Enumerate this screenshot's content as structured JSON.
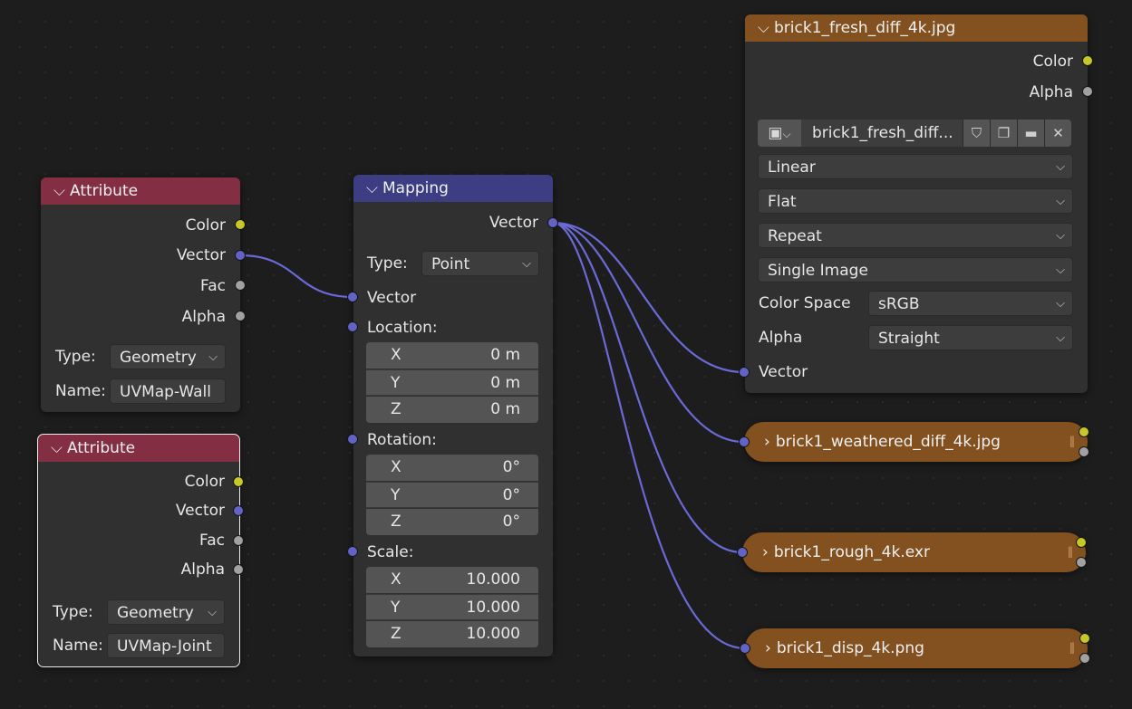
{
  "attr1": {
    "title": "Attribute",
    "outputs": [
      "Color",
      "Vector",
      "Fac",
      "Alpha"
    ],
    "type_label": "Type:",
    "type_value": "Geometry",
    "name_label": "Name:",
    "name_value": "UVMap-Wall"
  },
  "attr2": {
    "title": "Attribute",
    "outputs": [
      "Color",
      "Vector",
      "Fac",
      "Alpha"
    ],
    "type_label": "Type:",
    "type_value": "Geometry",
    "name_label": "Name:",
    "name_value": "UVMap-Joint"
  },
  "mapping": {
    "title": "Mapping",
    "output": "Vector",
    "type_label": "Type:",
    "type_value": "Point",
    "input_vector": "Vector",
    "location_label": "Location:",
    "location": [
      {
        "axis": "X",
        "value": "0 m"
      },
      {
        "axis": "Y",
        "value": "0 m"
      },
      {
        "axis": "Z",
        "value": "0 m"
      }
    ],
    "rotation_label": "Rotation:",
    "rotation": [
      {
        "axis": "X",
        "value": "0°"
      },
      {
        "axis": "Y",
        "value": "0°"
      },
      {
        "axis": "Z",
        "value": "0°"
      }
    ],
    "scale_label": "Scale:",
    "scale": [
      {
        "axis": "X",
        "value": "10.000"
      },
      {
        "axis": "Y",
        "value": "10.000"
      },
      {
        "axis": "Z",
        "value": "10.000"
      }
    ]
  },
  "image_node": {
    "title": "brick1_fresh_diff_4k.jpg",
    "outputs": [
      "Color",
      "Alpha"
    ],
    "image_name": "brick1_fresh_diff...",
    "interpolation": "Linear",
    "projection": "Flat",
    "extension": "Repeat",
    "source": "Single Image",
    "color_space_label": "Color Space",
    "color_space": "sRGB",
    "alpha_label": "Alpha",
    "alpha": "Straight",
    "input_vector": "Vector"
  },
  "collapsed_nodes": [
    {
      "title": "brick1_weathered_diff_4k.jpg"
    },
    {
      "title": "brick1_rough_4k.exr"
    },
    {
      "title": "brick1_disp_4k.png"
    }
  ],
  "colors": {
    "attribute_header": "#842e43",
    "mapping_header": "#3d3d84",
    "texture_header": "#83511f",
    "socket_color": "#c7c729",
    "socket_vector": "#6363c7",
    "socket_float": "#a1a1a1",
    "wire": "#6a6ad6"
  },
  "icons": [
    "chevron-down-icon",
    "chevron-right-icon",
    "image-icon",
    "fake-user-shield-icon",
    "duplicate-icon",
    "folder-icon",
    "close-icon",
    "grip-icon"
  ]
}
